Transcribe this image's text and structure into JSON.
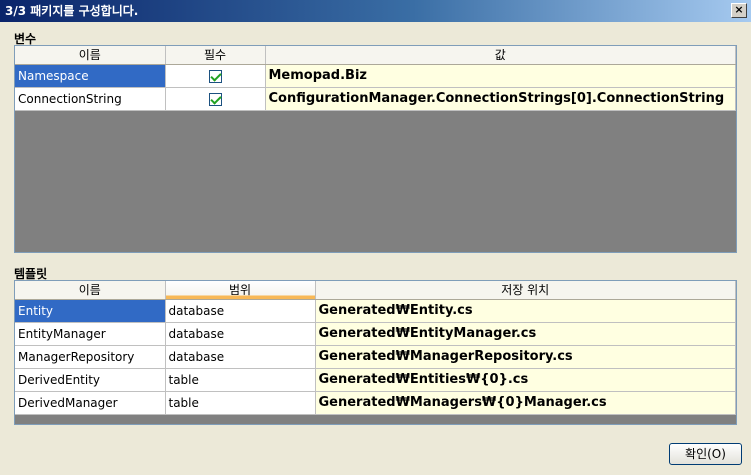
{
  "window": {
    "title": "3/3 패키지를 구성합니다.",
    "close_label": "×"
  },
  "variables": {
    "label": "변수",
    "headers": [
      "이름",
      "필수",
      "값"
    ],
    "rows": [
      {
        "name": "Namespace",
        "required": true,
        "value": "Memopad.Biz"
      },
      {
        "name": "ConnectionString",
        "required": true,
        "value": "ConfigurationManager.ConnectionStrings[0].ConnectionString"
      }
    ]
  },
  "templates": {
    "label": "템플릿",
    "headers": [
      "이름",
      "범위",
      "저장 위치"
    ],
    "rows": [
      {
        "name": "Entity",
        "scope": "database",
        "location": "Generated₩Entity.cs"
      },
      {
        "name": "EntityManager",
        "scope": "database",
        "location": "Generated₩EntityManager.cs"
      },
      {
        "name": "ManagerRepository",
        "scope": "database",
        "location": "Generated₩ManagerRepository.cs"
      },
      {
        "name": "DerivedEntity",
        "scope": "table",
        "location": "Generated₩Entities₩{0}.cs"
      },
      {
        "name": "DerivedManager",
        "scope": "table",
        "location": "Generated₩Managers₩{0}Manager.cs"
      }
    ]
  },
  "ok_button": {
    "label": "확인(O)"
  },
  "colors": {
    "selection": "#316ac5",
    "value_background": "#ffffe1",
    "empty_grid": "#808080"
  }
}
